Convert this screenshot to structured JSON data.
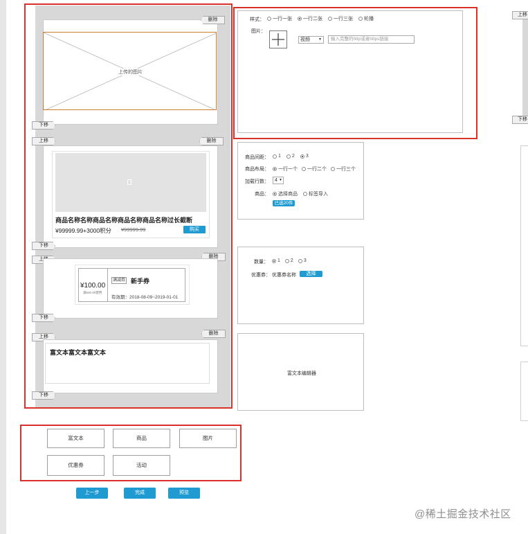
{
  "canvas": {
    "image_module": {
      "delete": "删除",
      "placeholder": "上传的图片",
      "down": "下移"
    },
    "product_module": {
      "up": "上移",
      "delete": "删除",
      "down": "下移",
      "title": "商品名称名称商品名称商品名称商品名称过长截断",
      "price": "¥99999.99+3000积分",
      "old_price": "¥99999.99",
      "buy": "购买"
    },
    "coupon_module": {
      "up": "上移",
      "delete": "删除",
      "down": "下移",
      "amount": "¥100.00",
      "condition": "满500.00使用",
      "tag": "满减券",
      "name": "新手券",
      "validity": "有效期：2018-08-09~2019-01-01"
    },
    "richtext_module": {
      "up": "上移",
      "delete": "删除",
      "down": "下移",
      "text": "富文本富文本富文本"
    }
  },
  "image_settings": {
    "style_label": "样式：",
    "style_options": [
      "一行一张",
      "一行二张",
      "一行三张",
      "轮播"
    ],
    "style_selected": 1,
    "image_label": "图片：",
    "link_select": "视频",
    "link_placeholder": "输入完整的http或者https链接"
  },
  "product_settings": {
    "spacing_label": "商品间距：",
    "spacing_options": [
      "1",
      "2",
      "3"
    ],
    "spacing_selected": 2,
    "layout_label": "商品布局：",
    "layout_options": [
      "一行一个",
      "一行二个",
      "一行三个"
    ],
    "layout_selected": 0,
    "rows_label": "加载行数：",
    "rows_value": "4",
    "goods_label": "商品：",
    "goods_options": [
      "选择商品",
      "标签导入"
    ],
    "goods_selected": 0,
    "selected_count": "已选20件"
  },
  "coupon_settings": {
    "count_label": "数量：",
    "count_options": [
      "1",
      "2",
      "3"
    ],
    "count_selected": 0,
    "coupon_label": "优惠券：",
    "coupon_name": "优惠券名称",
    "choose": "选择"
  },
  "richtext_settings": {
    "editor": "富文本编辑器"
  },
  "components": [
    "富文本",
    "商品",
    "图片",
    "优惠券",
    "活动"
  ],
  "nav": {
    "prev": "上一步",
    "done": "完成",
    "preview": "预览"
  },
  "right_edge": {
    "up": "上移",
    "down": "下移"
  },
  "watermark": "@稀土掘金技术社区",
  "colors": {
    "accent": "#1f9bd1",
    "highlight": "#d9302a"
  }
}
